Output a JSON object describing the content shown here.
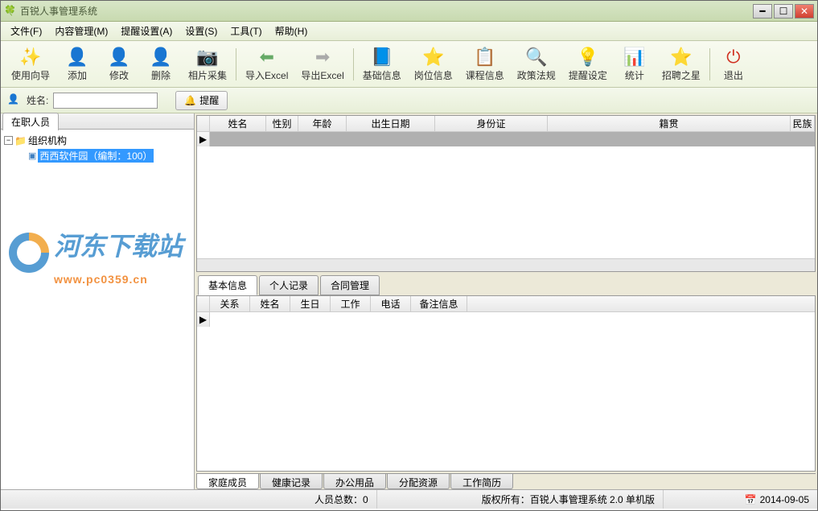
{
  "window": {
    "title": "百锐人事管理系统"
  },
  "menu": {
    "file": "文件(F)",
    "content": "内容管理(M)",
    "remind": "提醒设置(A)",
    "settings": "设置(S)",
    "tools": "工具(T)",
    "help": "帮助(H)"
  },
  "toolbar": {
    "wizard": "使用向导",
    "add": "添加",
    "edit": "修改",
    "delete": "删除",
    "photo": "相片采集",
    "import": "导入Excel",
    "export": "导出Excel",
    "basic": "基础信息",
    "post": "岗位信息",
    "course": "课程信息",
    "policy": "政策法规",
    "remindset": "提醒设定",
    "stats": "统计",
    "recruit": "招聘之星",
    "exit": "退出"
  },
  "search": {
    "name_label": "姓名:",
    "name_value": "",
    "remind_btn": "提醒"
  },
  "sidebar": {
    "tab": "在职人员",
    "root": "组织机构",
    "leaf": "西西软件园（编制：100）"
  },
  "upper_grid": {
    "cols": [
      "姓名",
      "性别",
      "年龄",
      "出生日期",
      "身份证",
      "籍贯",
      "民族"
    ]
  },
  "mid_tabs": {
    "basic": "基本信息",
    "personal": "个人记录",
    "contract": "合同管理"
  },
  "lower_grid": {
    "cols": [
      "关系",
      "姓名",
      "生日",
      "工作",
      "电话",
      "备注信息"
    ]
  },
  "bottom_tabs": {
    "family": "家庭成员",
    "health": "健康记录",
    "office": "办公用品",
    "resource": "分配资源",
    "resume": "工作简历"
  },
  "status": {
    "count_label": "人员总数：",
    "count_value": "0",
    "copyright": "版权所有：百锐人事管理系统 2.0 单机版",
    "date": "2014-09-05"
  },
  "watermark": {
    "text": "河东下载站",
    "url": "www.pc0359.cn"
  }
}
